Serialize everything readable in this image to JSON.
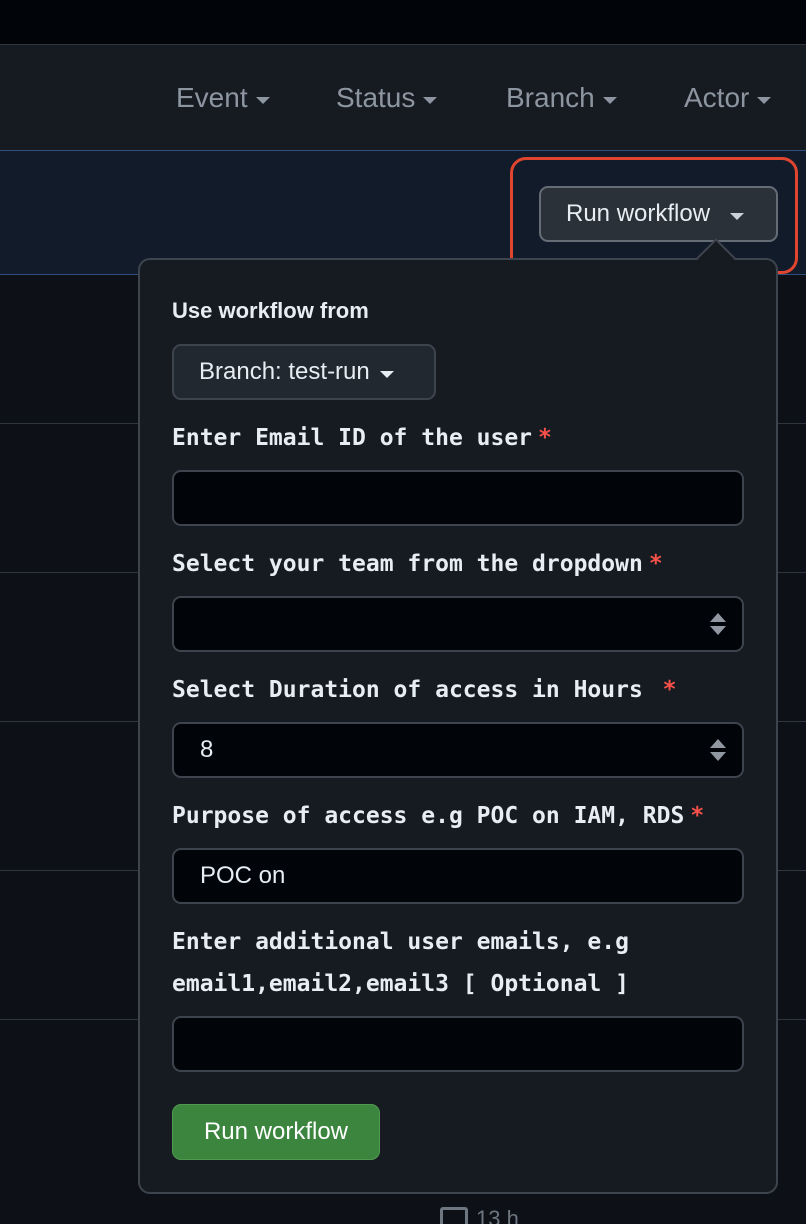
{
  "filters": [
    {
      "label": "Event"
    },
    {
      "label": "Status"
    },
    {
      "label": "Branch"
    },
    {
      "label": "Actor"
    }
  ],
  "run_button_label": "Run workflow",
  "popover": {
    "use_workflow_from": "Use workflow from",
    "branch_label": "Branch: test-run",
    "fields": [
      {
        "label": "Enter Email ID of the user",
        "required_mark": "*",
        "value": ""
      },
      {
        "label": "Select your team from the dropdown",
        "required_mark": "*",
        "value": ""
      },
      {
        "label": "Select Duration of access in Hours ",
        "required_mark": "*",
        "value": "8"
      },
      {
        "label": "Purpose of access e.g POC on IAM, RDS",
        "required_mark": "*",
        "value": "POC on"
      },
      {
        "label_line1": "Enter additional user emails, e.g",
        "label_line2": "email1,email2,email3 [ Optional ]",
        "value": ""
      }
    ],
    "submit_label": "Run workflow"
  },
  "background": {
    "footer_text": "13 h"
  },
  "colors": {
    "required": "#f85149",
    "submit": "#3c853f",
    "highlight": "#e0452f"
  }
}
